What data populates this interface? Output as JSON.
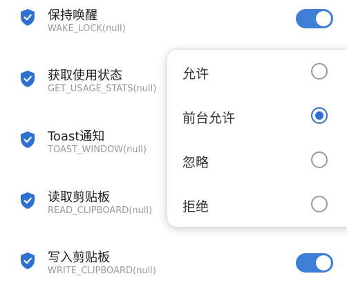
{
  "permissions": [
    {
      "title": "保持唤醒",
      "subtitle": "WAKE_LOCK(null)",
      "icon": "shield-check-icon",
      "toggle_on": true
    },
    {
      "title": "获取使用状态",
      "subtitle": "GET_USAGE_STATS(null)",
      "icon": "shield-check-icon"
    },
    {
      "title": "Toast通知",
      "subtitle": "TOAST_WINDOW(null)",
      "icon": "shield-check-icon"
    },
    {
      "title": "读取剪贴板",
      "subtitle": "READ_CLIPBOARD(null)",
      "icon": "shield-check-icon"
    },
    {
      "title": "写入剪贴板",
      "subtitle": "WRITE_CLIPBOARD(null)",
      "icon": "shield-check-icon",
      "toggle_on": true
    }
  ],
  "popup": {
    "options": [
      {
        "label": "允许",
        "selected": false
      },
      {
        "label": "前台允许",
        "selected": true
      },
      {
        "label": "忽略",
        "selected": false
      },
      {
        "label": "拒绝",
        "selected": false
      }
    ]
  },
  "colors": {
    "accent": "#3d7fd6",
    "radio_selected": "#2f6fd0",
    "icon": "#2f6fd0"
  }
}
